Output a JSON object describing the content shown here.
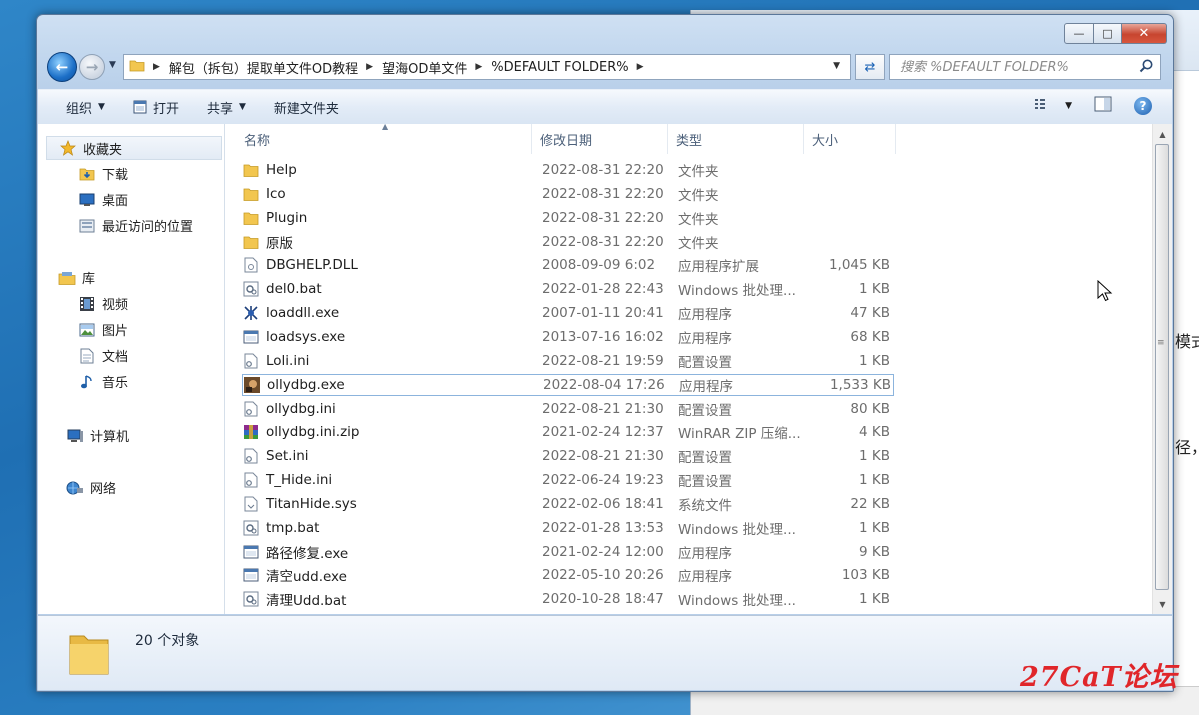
{
  "background_window": {
    "text_line1": "模式",
    "text_line2": "径，"
  },
  "window": {
    "caption": {
      "min": "—",
      "max": "□",
      "close": "✕"
    },
    "address": {
      "crumbs": [
        "解包（拆包）提取单文件OD教程",
        "望海OD单文件",
        "%DEFAULT FOLDER%"
      ]
    },
    "search": {
      "placeholder": "搜索 %DEFAULT FOLDER%"
    },
    "toolbar": {
      "organize": "组织",
      "open": "打开",
      "share": "共享",
      "new_folder": "新建文件夹"
    },
    "nav_pane": {
      "favorites": {
        "label": "收藏夹",
        "items": [
          "下载",
          "桌面",
          "最近访问的位置"
        ]
      },
      "libraries": {
        "label": "库",
        "items": [
          "视频",
          "图片",
          "文档",
          "音乐"
        ]
      },
      "computer": "计算机",
      "network": "网络"
    },
    "columns": {
      "name": "名称",
      "date": "修改日期",
      "type": "类型",
      "size": "大小"
    },
    "files": [
      {
        "name": "Help",
        "date": "2022-08-31 22:20",
        "type": "文件夹",
        "size": "",
        "icon": "folder-icon"
      },
      {
        "name": "Ico",
        "date": "2022-08-31 22:20",
        "type": "文件夹",
        "size": "",
        "icon": "folder-icon"
      },
      {
        "name": "Plugin",
        "date": "2022-08-31 22:20",
        "type": "文件夹",
        "size": "",
        "icon": "folder-icon"
      },
      {
        "name": "原版",
        "date": "2022-08-31 22:20",
        "type": "文件夹",
        "size": "",
        "icon": "folder-icon"
      },
      {
        "name": "DBGHELP.DLL",
        "date": "2008-09-09 6:02",
        "type": "应用程序扩展",
        "size": "1,045 KB",
        "icon": "dll-icon"
      },
      {
        "name": "del0.bat",
        "date": "2022-01-28 22:43",
        "type": "Windows 批处理...",
        "size": "1 KB",
        "icon": "bat-icon"
      },
      {
        "name": "loaddll.exe",
        "date": "2007-01-11 20:41",
        "type": "应用程序",
        "size": "47 KB",
        "icon": "bug-icon"
      },
      {
        "name": "loadsys.exe",
        "date": "2013-07-16 16:02",
        "type": "应用程序",
        "size": "68 KB",
        "icon": "exe-icon"
      },
      {
        "name": "Loli.ini",
        "date": "2022-08-21 19:59",
        "type": "配置设置",
        "size": "1 KB",
        "icon": "ini-icon"
      },
      {
        "name": "ollydbg.exe",
        "date": "2022-08-04 17:26",
        "type": "应用程序",
        "size": "1,533 KB",
        "icon": "ollydbg-icon",
        "selected": true
      },
      {
        "name": "ollydbg.ini",
        "date": "2022-08-21 21:30",
        "type": "配置设置",
        "size": "80 KB",
        "icon": "ini-icon"
      },
      {
        "name": "ollydbg.ini.zip",
        "date": "2021-02-24 12:37",
        "type": "WinRAR ZIP 压缩...",
        "size": "4 KB",
        "icon": "winrar-icon"
      },
      {
        "name": "Set.ini",
        "date": "2022-08-21 21:30",
        "type": "配置设置",
        "size": "1 KB",
        "icon": "ini-icon"
      },
      {
        "name": "T_Hide.ini",
        "date": "2022-06-24 19:23",
        "type": "配置设置",
        "size": "1 KB",
        "icon": "ini-icon"
      },
      {
        "name": "TitanHide.sys",
        "date": "2022-02-06 18:41",
        "type": "系统文件",
        "size": "22 KB",
        "icon": "sys-icon"
      },
      {
        "name": "tmp.bat",
        "date": "2022-01-28 13:53",
        "type": "Windows 批处理...",
        "size": "1 KB",
        "icon": "bat-icon"
      },
      {
        "name": "路径修复.exe",
        "date": "2021-02-24 12:00",
        "type": "应用程序",
        "size": "9 KB",
        "icon": "exe-icon"
      },
      {
        "name": "清空udd.exe",
        "date": "2022-05-10 20:26",
        "type": "应用程序",
        "size": "103 KB",
        "icon": "exe-icon"
      },
      {
        "name": "清理Udd.bat",
        "date": "2020-10-28 18:47",
        "type": "Windows 批处理...",
        "size": "1 KB",
        "icon": "bat-icon"
      }
    ],
    "details": {
      "count": "20 个对象"
    }
  },
  "watermark": "27CaT论坛"
}
